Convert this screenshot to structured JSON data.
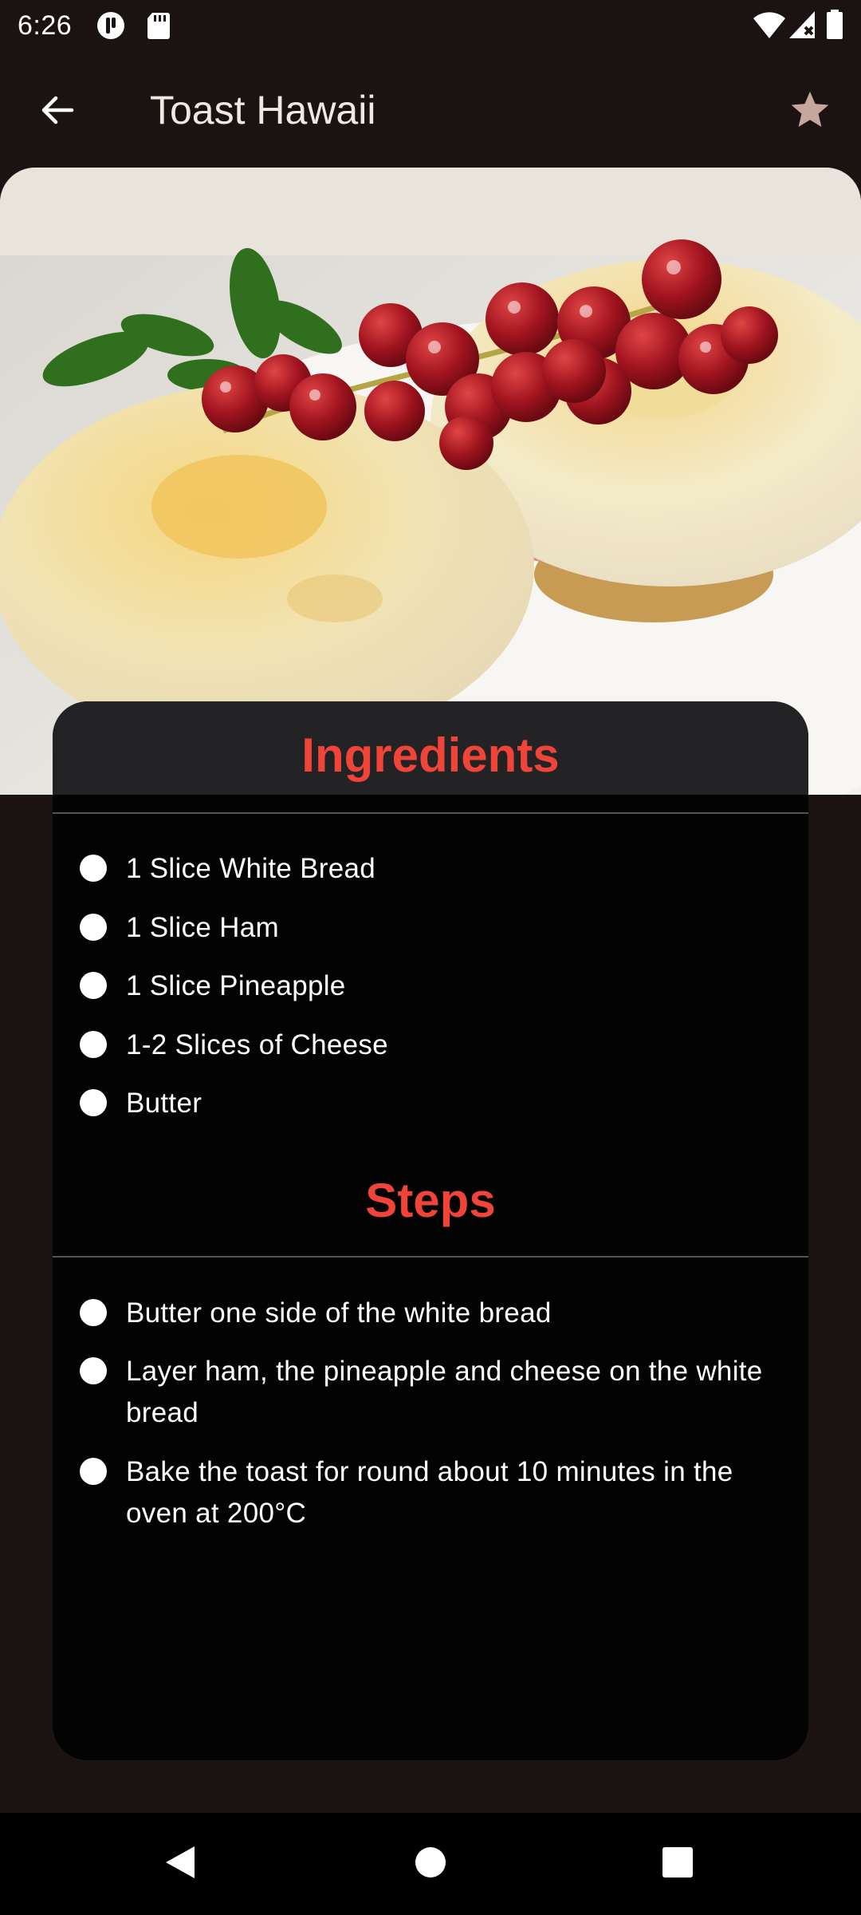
{
  "status_bar": {
    "time": "6:26",
    "left_icons": [
      "pocket-icon",
      "sd-card-icon"
    ],
    "right_icons": [
      "wifi-icon",
      "cell-signal-icon",
      "battery-icon"
    ]
  },
  "app_bar": {
    "title": "Toast Hawaii",
    "back_icon": "arrow-back-icon",
    "favorite_icon": "star-icon"
  },
  "hero_image": {
    "subject": "toast-hawaii-photo"
  },
  "ingredients": {
    "title": "Ingredients",
    "items": [
      "1 Slice White Bread",
      "1 Slice Ham",
      "1 Slice Pineapple",
      "1-2 Slices of Cheese",
      "Butter"
    ]
  },
  "steps": {
    "title": "Steps",
    "items": [
      "Butter one side of the white bread",
      "Layer ham, the pineapple and cheese on the white bread",
      "Bake the toast for round about 10 minutes in the oven at 200°C"
    ]
  },
  "nav_bar": {
    "icons": [
      "back-triangle-icon",
      "home-circle-icon",
      "recents-square-icon"
    ]
  },
  "colors": {
    "background": "#1a1311",
    "card": "#040303",
    "accent": "#f04438",
    "favorite": "#c7a79c"
  }
}
